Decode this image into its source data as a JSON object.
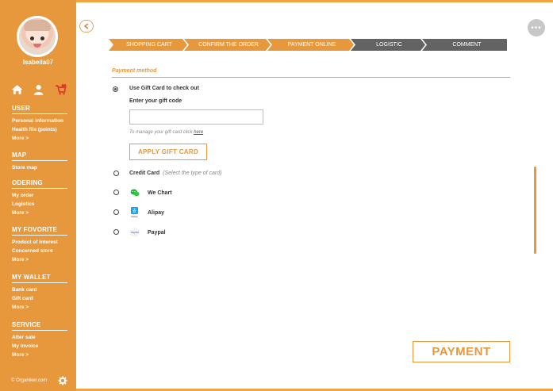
{
  "user": {
    "username": "Isabella07"
  },
  "colors": {
    "accent": "#e7983d",
    "step_active": "#e7983d",
    "step_inactive": "#636363",
    "text": "#333333"
  },
  "icons": {
    "home": "home-icon",
    "profile": "user-icon",
    "cart": "cart-icon",
    "collapse": "arrow-left-icon",
    "more": "more-dots-icon",
    "settings": "gear-icon"
  },
  "sidebar": {
    "sections": [
      {
        "title": "USER",
        "items": [
          "Personal information",
          "Health file (points)",
          "More >"
        ]
      },
      {
        "title": "MAP",
        "items": [
          "Store map"
        ]
      },
      {
        "title": "ODERING",
        "items": [
          "My order",
          "Logistics",
          "More >"
        ]
      },
      {
        "title": "MY FOVORITE",
        "items": [
          "Product of interest",
          "Concerned store",
          "More >"
        ]
      },
      {
        "title": "MY WALLET",
        "items": [
          "Bank card",
          "Gift card",
          "More >"
        ]
      },
      {
        "title": "SERVICE",
        "items": [
          "After sale",
          "My invoice",
          "More >"
        ]
      }
    ],
    "footer": "© Organiker.com"
  },
  "steps": [
    {
      "label": "SHOPPING CART",
      "active": true
    },
    {
      "label": "CONFIRM THE ORDER",
      "active": true
    },
    {
      "label": "PAYMENT ONLINE",
      "active": true
    },
    {
      "label": "LOGISTIC",
      "active": false
    },
    {
      "label": "COMMENT",
      "active": false
    }
  ],
  "payment": {
    "section_title": "Payment method",
    "gift_card": {
      "label": "Use Gift Card to check out",
      "code_label": "Enter your gift code",
      "input_value": "",
      "manage_note": "To manage your gift card click ",
      "manage_link": "here",
      "apply_label": "APPLY GIFT CARD",
      "selected": true
    },
    "methods": [
      {
        "label": "Credit Card",
        "hint": "(Select the type of card)",
        "icon": ""
      },
      {
        "label": "We Chart",
        "hint": "",
        "icon": "wechat-icon"
      },
      {
        "label": "Alipay",
        "hint": "",
        "icon": "alipay-icon",
        "icon_text": "Alipay"
      },
      {
        "label": "Paypal",
        "hint": "",
        "icon": "paypal-icon",
        "icon_text": "PayPal"
      }
    ],
    "submit_label": "PAYMENT"
  }
}
